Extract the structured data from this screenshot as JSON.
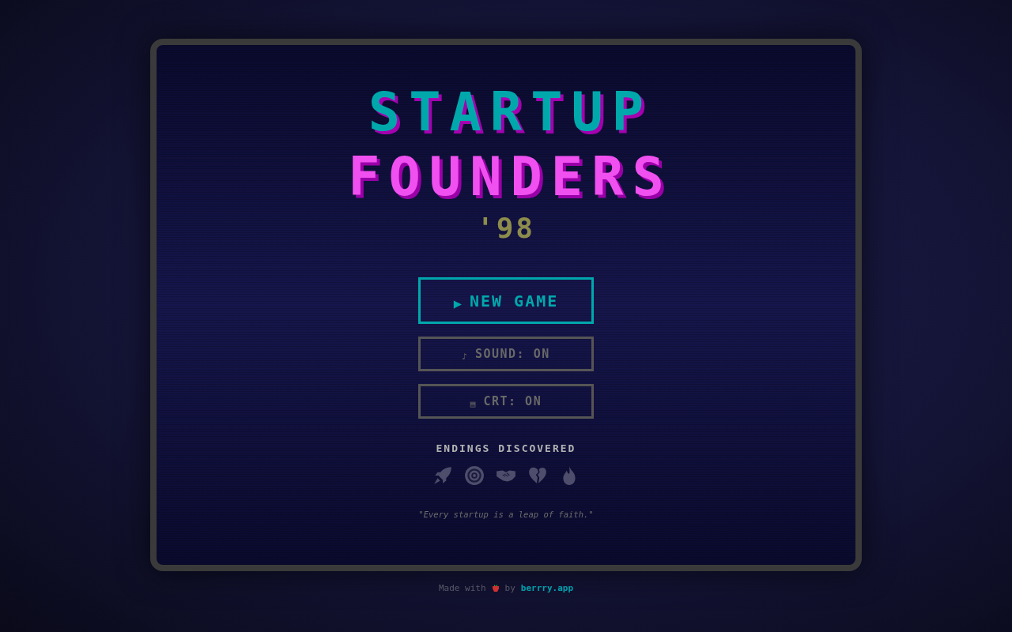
{
  "title": {
    "line_1": "STARTUP",
    "line_2": "FOUNDERS",
    "year": "'98"
  },
  "menu": [
    {
      "glyph": "▶",
      "label": "NEW GAME",
      "selected": true
    },
    {
      "glyph": "♪",
      "label": "SOUND: ON",
      "selected": false
    },
    {
      "glyph": "▤",
      "label": "CRT: ON",
      "selected": false
    }
  ],
  "endings": {
    "heading": "ENDINGS DISCOVERED",
    "items": [
      {
        "kind": "rocket",
        "discovered": false
      },
      {
        "kind": "target",
        "discovered": false
      },
      {
        "kind": "handshake",
        "discovered": false
      },
      {
        "kind": "heartbreak",
        "discovered": false
      },
      {
        "kind": "fire",
        "discovered": false
      }
    ]
  },
  "quote": "\"Every startup is a leap of faith.\"",
  "footer": {
    "text_before": "Made with",
    "text_after": "by",
    "link": "berrry.app"
  }
}
